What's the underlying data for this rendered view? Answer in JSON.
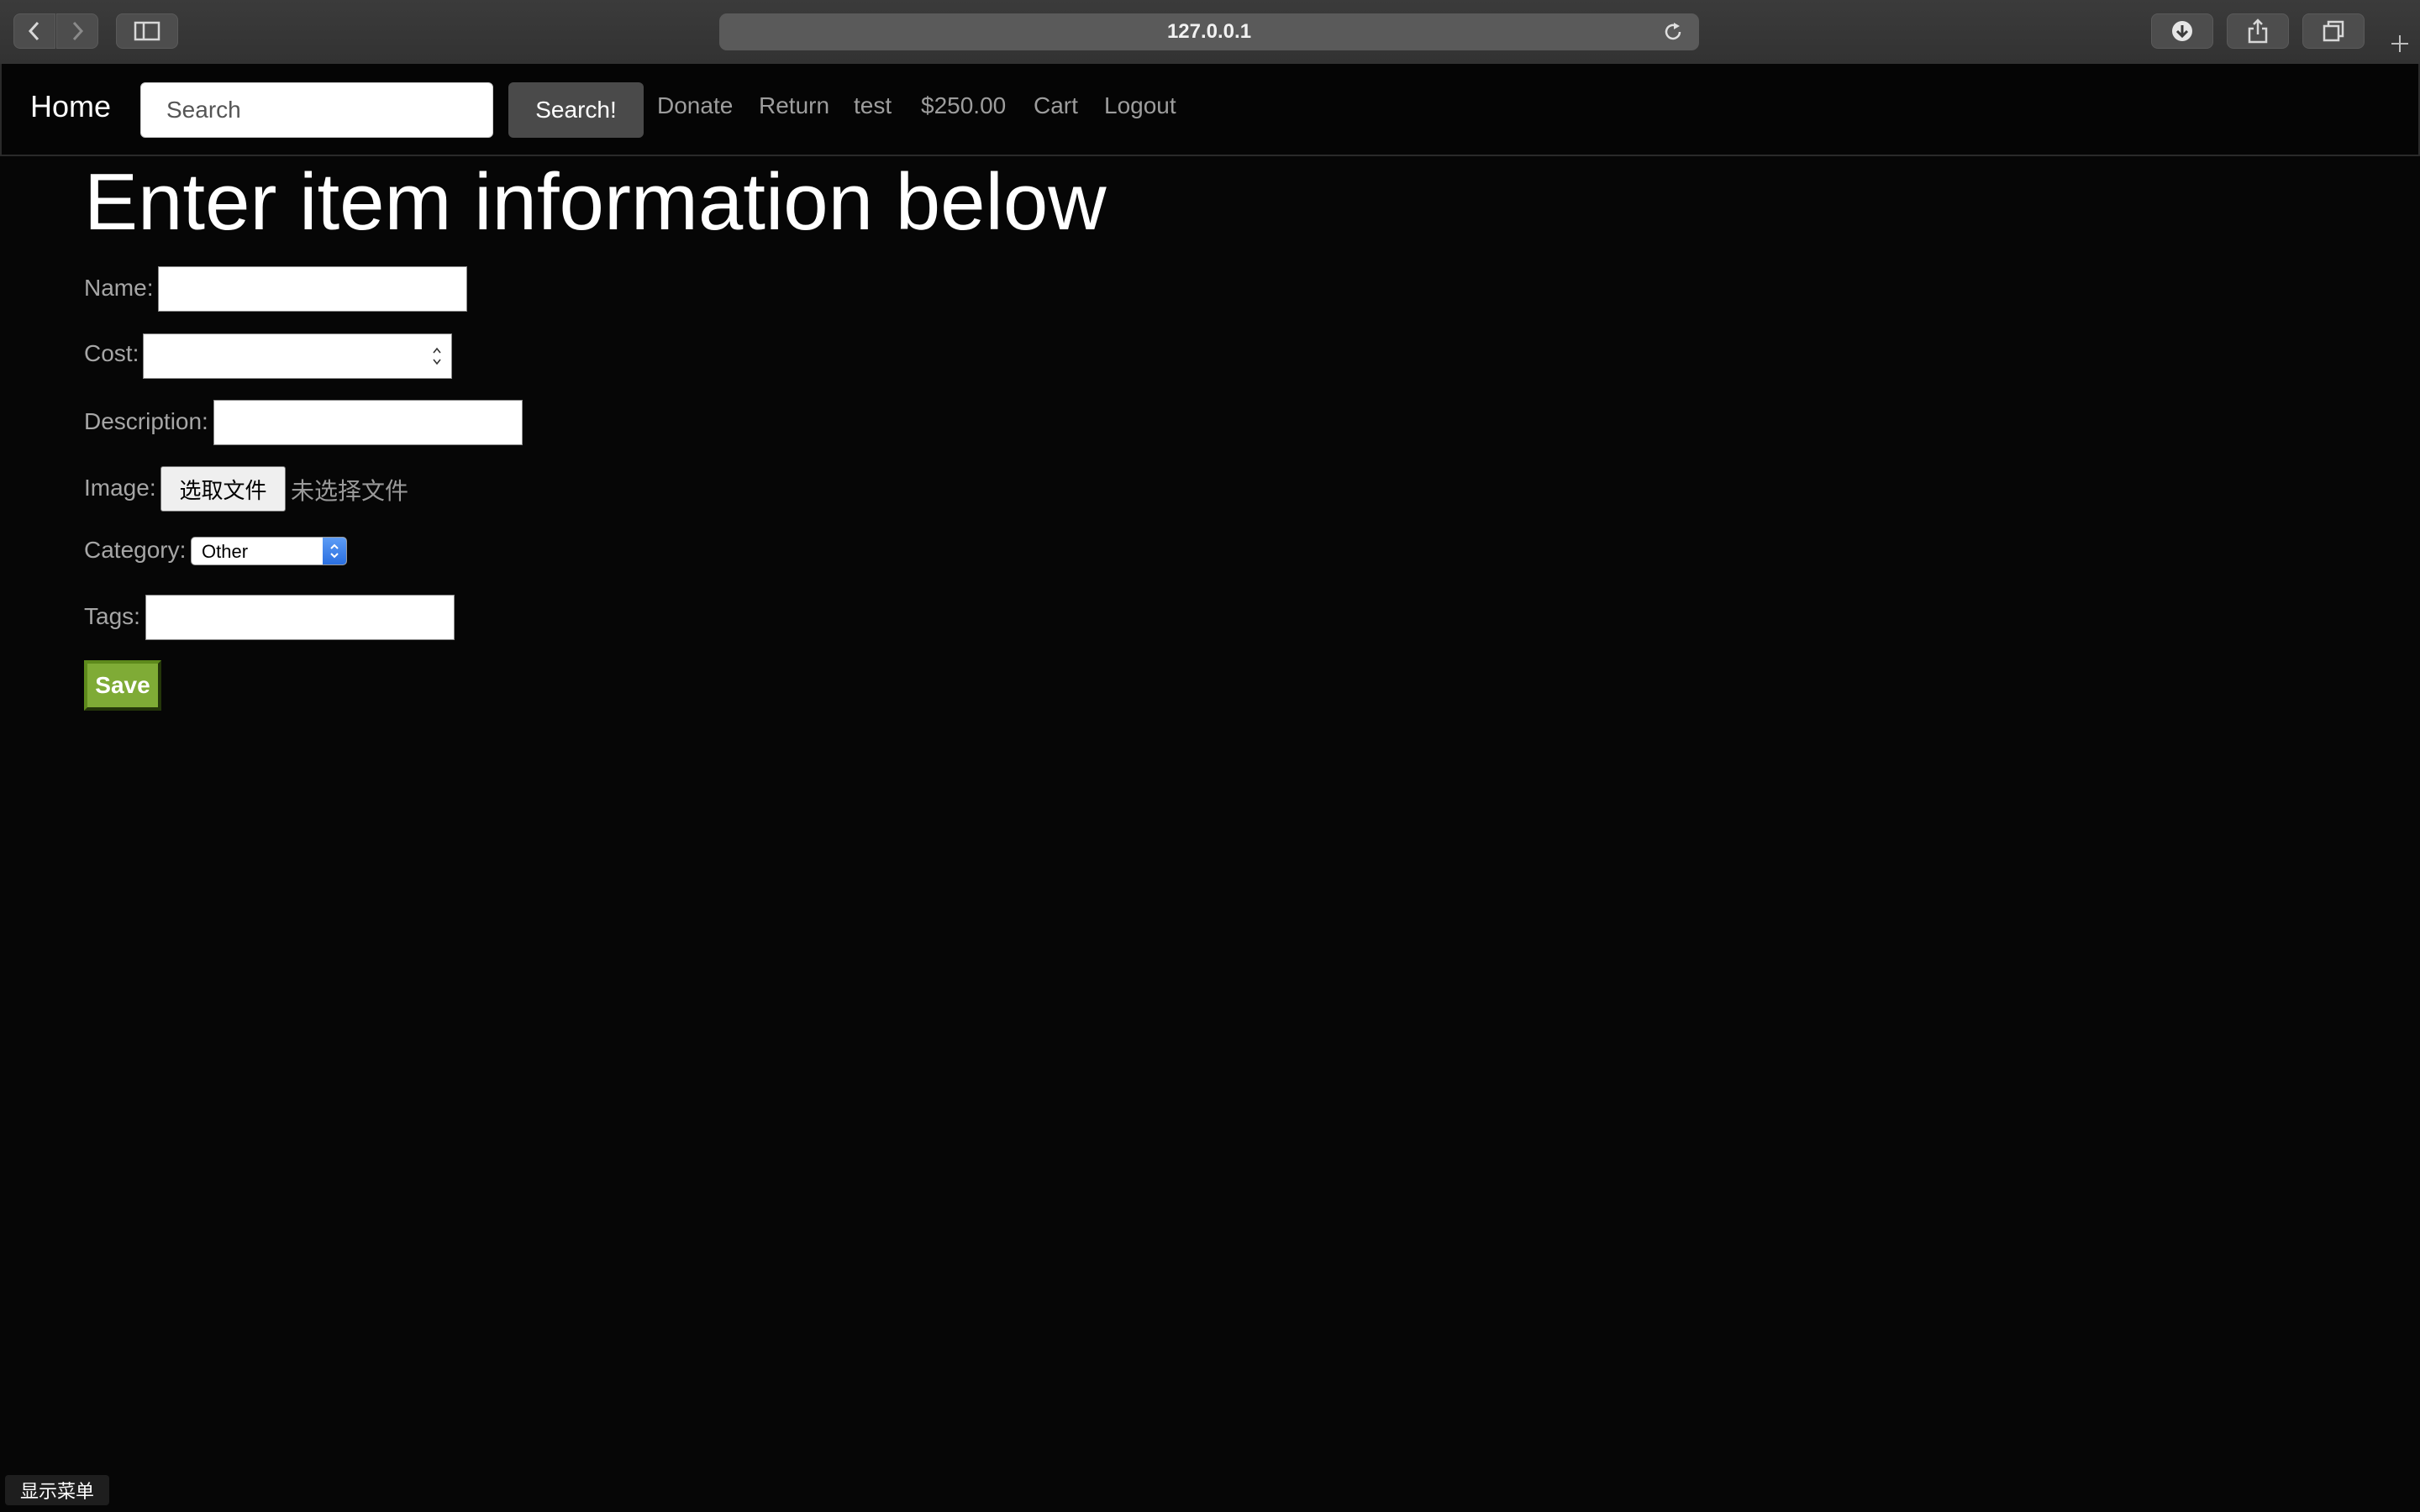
{
  "browser": {
    "url": "127.0.0.1"
  },
  "navbar": {
    "brand": "Home",
    "search_placeholder": "Search",
    "search_button": "Search!",
    "links": {
      "donate": "Donate",
      "return": "Return",
      "user": "test",
      "balance": "$250.00",
      "cart": "Cart",
      "logout": "Logout"
    }
  },
  "form": {
    "title": "Enter item information below",
    "name_label": "Name:",
    "name_value": "",
    "cost_label": "Cost:",
    "cost_value": "",
    "description_label": "Description:",
    "description_value": "",
    "image_label": "Image:",
    "choose_file_button": "选取文件",
    "no_file_text": "未选择文件",
    "category_label": "Category:",
    "category_selected": "Other",
    "tags_label": "Tags:",
    "tags_value": "",
    "save_button": "Save"
  },
  "footer": {
    "show_menu": "显示菜单"
  },
  "icons": {
    "back": "chevron-left-icon",
    "forward": "chevron-right-icon",
    "sidebar": "sidebar-icon",
    "reload": "reload-icon",
    "download": "download-icon",
    "share": "share-icon",
    "tabs": "tabs-icon",
    "new_tab": "plus-icon"
  },
  "colors": {
    "page_background": "#060606",
    "save_button": "#7fab36",
    "search_button": "#4a4a4a",
    "select_arrows": "#2a6fe0"
  }
}
